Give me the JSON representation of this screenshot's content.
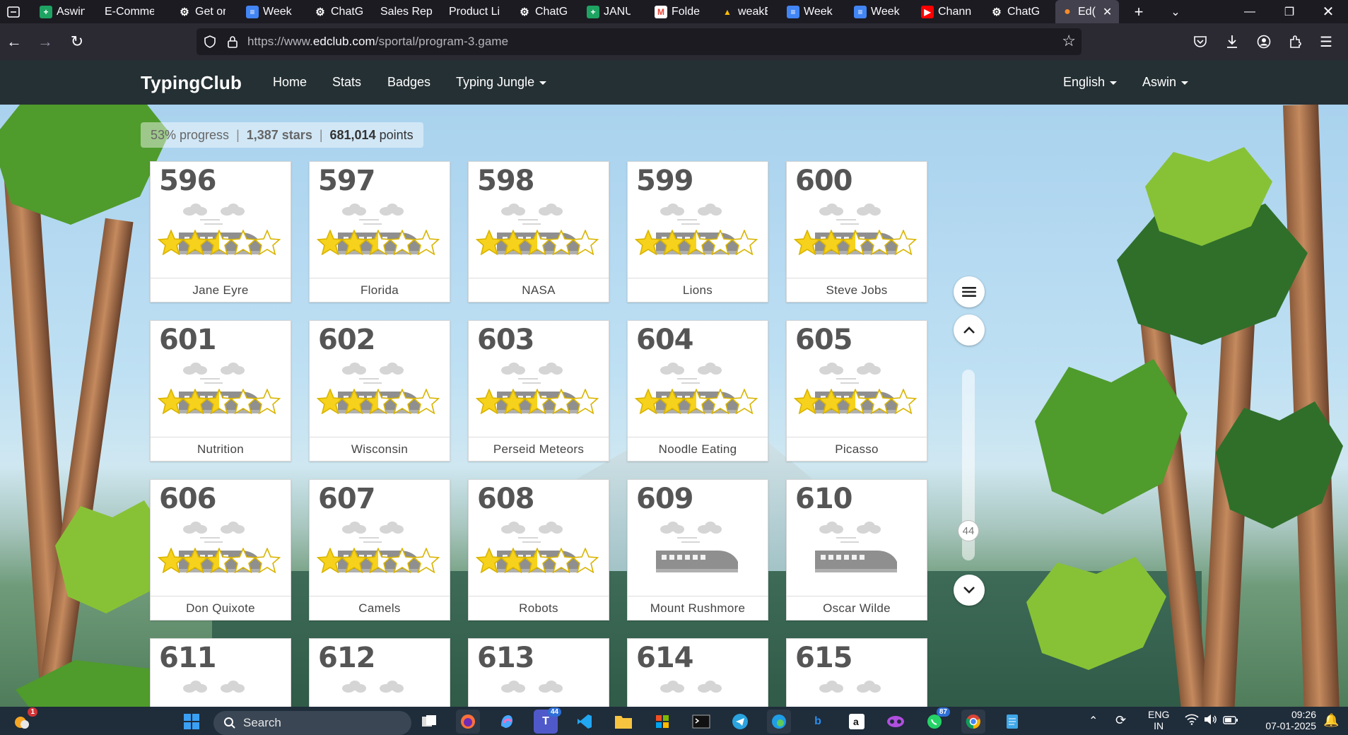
{
  "browser": {
    "tabs": [
      {
        "label": "Aswin",
        "icon": "sheets-icon",
        "color": "#1ea362"
      },
      {
        "label": "E-Comme",
        "icon": "none",
        "color": ""
      },
      {
        "label": "Get or",
        "icon": "chatgpt-icon",
        "color": "#ffffff"
      },
      {
        "label": "Week",
        "icon": "docs-icon",
        "color": "#4285f4"
      },
      {
        "label": "ChatG",
        "icon": "chatgpt-icon",
        "color": "#ffffff"
      },
      {
        "label": "Sales Rep",
        "icon": "none",
        "color": ""
      },
      {
        "label": "Product Li",
        "icon": "none",
        "color": ""
      },
      {
        "label": "ChatG",
        "icon": "chatgpt-icon",
        "color": "#ffffff"
      },
      {
        "label": "JANUA",
        "icon": "sheets-icon",
        "color": "#1ea362"
      },
      {
        "label": "Folde",
        "icon": "gmail-icon",
        "color": "#ea4335"
      },
      {
        "label": "weakE",
        "icon": "drive-icon",
        "color": "#fbbc04"
      },
      {
        "label": "Week",
        "icon": "docs-icon",
        "color": "#4285f4"
      },
      {
        "label": "Week",
        "icon": "docs-icon",
        "color": "#4285f4"
      },
      {
        "label": "Chann",
        "icon": "youtube-icon",
        "color": "#ff0000"
      },
      {
        "label": "ChatG",
        "icon": "chatgpt-icon",
        "color": "#ffffff"
      },
      {
        "label": "Ed(",
        "icon": "edclub-icon",
        "color": "#f58b2b"
      }
    ],
    "url_prefix": "https://www.",
    "url_domain": "edclub.com",
    "url_path": "/sportal/program-3.game"
  },
  "site": {
    "brand": "TypingClub",
    "nav": {
      "home": "Home",
      "stats": "Stats",
      "badges": "Badges",
      "jungle": "Typing Jungle"
    },
    "language": "English",
    "user": "Aswin"
  },
  "stats": {
    "progress": "53% progress",
    "stars": "1,387 stars",
    "points_value": "681,014",
    "points_label": "points"
  },
  "scroll_position": "44",
  "lessons": [
    {
      "num": "596",
      "title": "Jane Eyre",
      "stars": 2.5
    },
    {
      "num": "597",
      "title": "Florida",
      "stars": 2.5
    },
    {
      "num": "598",
      "title": "NASA",
      "stars": 2.5
    },
    {
      "num": "599",
      "title": "Lions",
      "stars": 2.5
    },
    {
      "num": "600",
      "title": "Steve Jobs",
      "stars": 2.5
    },
    {
      "num": "601",
      "title": "Nutrition",
      "stars": 2.5
    },
    {
      "num": "602",
      "title": "Wisconsin",
      "stars": 2.5
    },
    {
      "num": "603",
      "title": "Perseid Meteors",
      "stars": 2.5
    },
    {
      "num": "604",
      "title": "Noodle Eating",
      "stars": 2.5
    },
    {
      "num": "605",
      "title": "Picasso",
      "stars": 2.5
    },
    {
      "num": "606",
      "title": "Don Quixote",
      "stars": 2.5
    },
    {
      "num": "607",
      "title": "Camels",
      "stars": 2.5
    },
    {
      "num": "608",
      "title": "Robots",
      "stars": 2.5
    },
    {
      "num": "609",
      "title": "Mount Rushmore",
      "stars": 0
    },
    {
      "num": "610",
      "title": "Oscar Wilde",
      "stars": 0
    },
    {
      "num": "611",
      "title": "",
      "stars": 0
    },
    {
      "num": "612",
      "title": "",
      "stars": 0
    },
    {
      "num": "613",
      "title": "",
      "stars": 0
    },
    {
      "num": "614",
      "title": "",
      "stars": 0
    },
    {
      "num": "615",
      "title": "",
      "stars": 0
    }
  ],
  "taskbar": {
    "search_placeholder": "Search",
    "weather_badge": "1",
    "teams_badge": "44",
    "whatsapp_badge": "87",
    "lang_line1": "ENG",
    "lang_line2": "IN",
    "time": "09:26",
    "date": "07-01-2025"
  }
}
